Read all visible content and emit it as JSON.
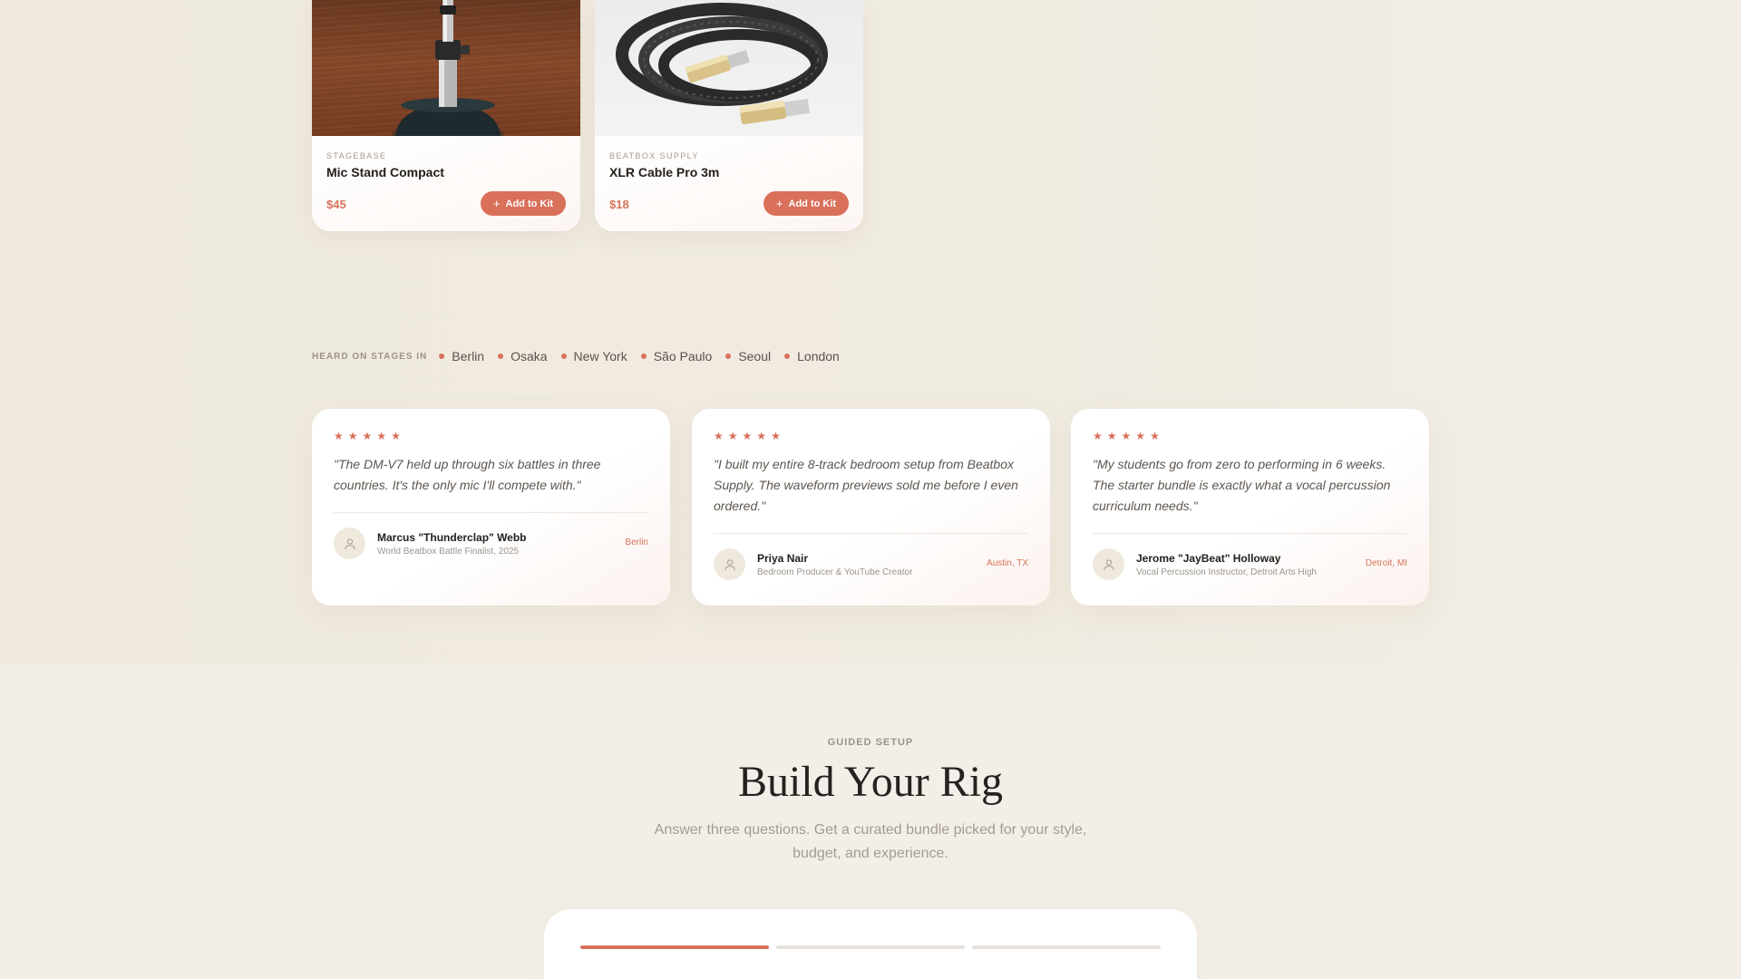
{
  "products": [
    {
      "brand": "STAGEBASE",
      "name": "Mic Stand Compact",
      "price": "$45",
      "add_label": "Add to Kit",
      "image_icon": "mic-stand-photo"
    },
    {
      "brand": "BEATBOX SUPPLY",
      "name": "XLR Cable Pro 3m",
      "price": "$18",
      "add_label": "Add to Kit",
      "image_icon": "cable-photo"
    }
  ],
  "stages": {
    "label": "HEARD ON STAGES IN",
    "cities": [
      "Berlin",
      "Osaka",
      "New York",
      "São Paulo",
      "Seoul",
      "London"
    ]
  },
  "testimonials": [
    {
      "rating": 5,
      "quote": "\"The DM-V7 held up through six battles in three countries. It's the only mic I'll compete with.\"",
      "name": "Marcus \"Thunderclap\" Webb",
      "role": "World Beatbox Battle Finalist, 2025",
      "city": "Berlin"
    },
    {
      "rating": 5,
      "quote": "\"I built my entire 8-track bedroom setup from Beatbox Supply. The waveform previews sold me before I even ordered.\"",
      "name": "Priya Nair",
      "role": "Bedroom Producer & YouTube Creator",
      "city": "Austin, TX"
    },
    {
      "rating": 5,
      "quote": "\"My students go from zero to performing in 6 weeks. The starter bundle is exactly what a vocal percussion curriculum needs.\"",
      "name": "Jerome \"JayBeat\" Holloway",
      "role": "Vocal Percussion Instructor, Detroit Arts High",
      "city": "Detroit, MI"
    }
  ],
  "build": {
    "eyebrow": "GUIDED SETUP",
    "title": "Build Your Rig",
    "subtitle": "Answer three questions. Get a curated bundle picked for your style, budget, and experience.",
    "progress": {
      "current_step": 1,
      "total_steps": 3
    }
  },
  "colors": {
    "accent": "#d9705a",
    "background": "#f0ebe1",
    "text": "#23201d"
  }
}
